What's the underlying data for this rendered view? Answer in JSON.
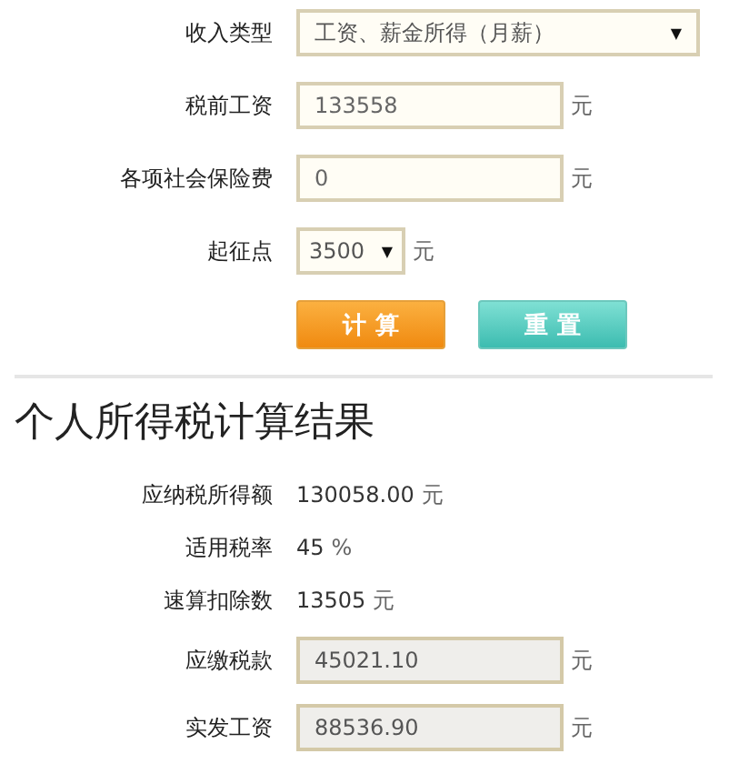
{
  "form": {
    "income_type": {
      "label": "收入类型",
      "value": "工资、薪金所得（月薪）",
      "arrow": "▼"
    },
    "salary": {
      "label": "税前工资",
      "value": "133558",
      "unit": "元"
    },
    "insurance": {
      "label": "各项社会保险费",
      "value": "0",
      "unit": "元"
    },
    "threshold": {
      "label": "起征点",
      "value": "3500",
      "arrow": "▼",
      "unit": "元"
    },
    "buttons": [
      {
        "label": "计 算",
        "kind": "primary"
      },
      {
        "label": "重 置",
        "kind": "secondary"
      }
    ]
  },
  "results": {
    "title": "个人所得税计算结果",
    "rows": [
      {
        "kind": "text",
        "label": "应纳税所得额",
        "value": "130058.00",
        "unit": "元"
      },
      {
        "kind": "text",
        "label": "适用税率",
        "value": "45",
        "unit": "%"
      },
      {
        "kind": "text",
        "label": "速算扣除数",
        "value": "13505",
        "unit": "元"
      },
      {
        "kind": "field",
        "label": "应缴税款",
        "value": "45021.10",
        "unit": "元"
      },
      {
        "kind": "field",
        "label": "实发工资",
        "value": "88536.90",
        "unit": "元"
      }
    ]
  }
}
